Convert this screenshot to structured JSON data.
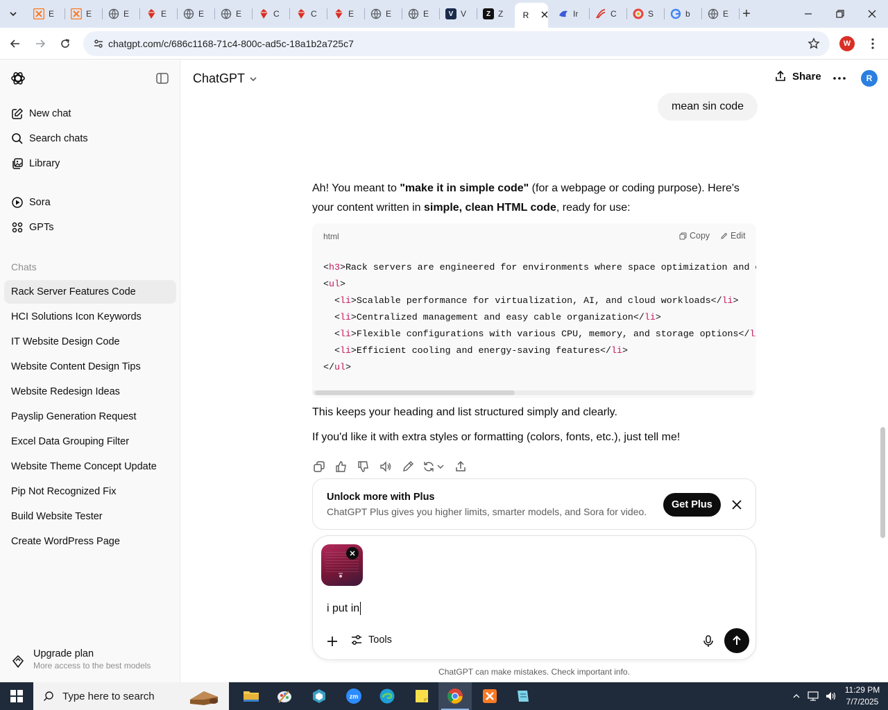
{
  "browser": {
    "tabs": [
      {
        "label": "E",
        "icon": "xampp-icon",
        "color": "#fb7a24"
      },
      {
        "label": "E",
        "icon": "xampp-icon",
        "color": "#fb7a24"
      },
      {
        "label": "E",
        "icon": "globe-icon",
        "color": "#5f6368"
      },
      {
        "label": "E",
        "icon": "gem-icon",
        "color": "#d93025"
      },
      {
        "label": "E",
        "icon": "globe-icon",
        "color": "#5f6368"
      },
      {
        "label": "E",
        "icon": "globe-icon",
        "color": "#5f6368"
      },
      {
        "label": "C",
        "icon": "gem-icon",
        "color": "#d93025"
      },
      {
        "label": "C",
        "icon": "gem-icon",
        "color": "#d93025"
      },
      {
        "label": "E",
        "icon": "gem-icon",
        "color": "#d93025"
      },
      {
        "label": "E",
        "icon": "globe-icon",
        "color": "#5f6368"
      },
      {
        "label": "E",
        "icon": "globe-icon",
        "color": "#5f6368"
      },
      {
        "label": "V",
        "icon": "v-logo-icon",
        "color": "#1a2b4c"
      },
      {
        "label": "Z",
        "icon": "z-logo-icon",
        "color": "#111111"
      },
      {
        "label": "R",
        "icon": "chatgpt-icon",
        "color": "#111111",
        "active": true
      },
      {
        "label": "Ir",
        "icon": "bird-icon",
        "color": "#3b5bdb"
      },
      {
        "label": "C",
        "icon": "swoosh-icon",
        "color": "#d93025"
      },
      {
        "label": "S",
        "icon": "ring-icon",
        "color": "#e8453c"
      },
      {
        "label": "b",
        "icon": "google-icon",
        "color": "#4285f4"
      },
      {
        "label": "E",
        "icon": "globe-icon",
        "color": "#5f6368"
      }
    ],
    "url": "chatgpt.com/c/686c1168-71c4-800c-ad5c-18a1b2a725c7",
    "profile_initial": "W"
  },
  "sidebar": {
    "nav": [
      {
        "label": "New chat",
        "icon": "edit-icon"
      },
      {
        "label": "Search chats",
        "icon": "search-icon"
      },
      {
        "label": "Library",
        "icon": "library-icon"
      },
      {
        "label": "Sora",
        "icon": "play-circle-icon"
      },
      {
        "label": "GPTs",
        "icon": "grid-icon"
      }
    ],
    "section_label": "Chats",
    "chats": [
      "Rack Server Features Code",
      "HCI Solutions Icon Keywords",
      "IT Website Design Code",
      "Website Content Design Tips",
      "Website Redesign Ideas",
      "Payslip Generation Request",
      "Excel Data Grouping Filter",
      "Website Theme Concept Update",
      "Pip Not Recognized Fix",
      "Build Website Tester",
      "Create WordPress Page"
    ],
    "upgrade": {
      "title": "Upgrade plan",
      "subtitle": "More access to the best models"
    }
  },
  "header": {
    "model": "ChatGPT",
    "share_label": "Share",
    "avatar_initial": "R"
  },
  "conversation": {
    "user_message": "mean sin code",
    "intro": {
      "p1": "Ah! You meant to ",
      "b1": "\"make it in simple code\"",
      "p2": " (for a webpage or coding purpose). Here's your content written in ",
      "b2": "simple, clean HTML code",
      "p3": ", ready for use:"
    },
    "code": {
      "lang": "html",
      "copy_label": "Copy",
      "edit_label": "Edit",
      "lines": [
        {
          "indent": "",
          "open": "h3",
          "text": "Rack servers are engineered for environments where space optimization and com",
          "close": ""
        },
        {
          "indent": "",
          "open": "ul",
          "text": "",
          "close": ""
        },
        {
          "indent": "  ",
          "open": "li",
          "text": "Scalable performance for virtualization, AI, and cloud workloads",
          "close": "li"
        },
        {
          "indent": "  ",
          "open": "li",
          "text": "Centralized management and easy cable organization",
          "close": "li"
        },
        {
          "indent": "  ",
          "open": "li",
          "text": "Flexible configurations with various CPU, memory, and storage options",
          "close": "li"
        },
        {
          "indent": "  ",
          "open": "li",
          "text": "Efficient cooling and energy-saving features",
          "close": "li"
        },
        {
          "indent": "",
          "open": "",
          "text": "",
          "close": "ul"
        }
      ]
    },
    "after1": "This keeps your heading and list structured simply and clearly.",
    "after2": "If you'd like it with extra styles or formatting (colors, fonts, etc.), just tell me!"
  },
  "plus_banner": {
    "title": "Unlock more with Plus",
    "description": "ChatGPT Plus gives you higher limits, smarter models, and Sora for video.",
    "button": "Get Plus"
  },
  "composer": {
    "input_value": "i put in",
    "tools_label": "Tools"
  },
  "disclaimer": "ChatGPT can make mistakes. Check important info.",
  "taskbar": {
    "search_placeholder": "Type here to search",
    "time": "11:29 PM",
    "date": "7/7/2025"
  }
}
